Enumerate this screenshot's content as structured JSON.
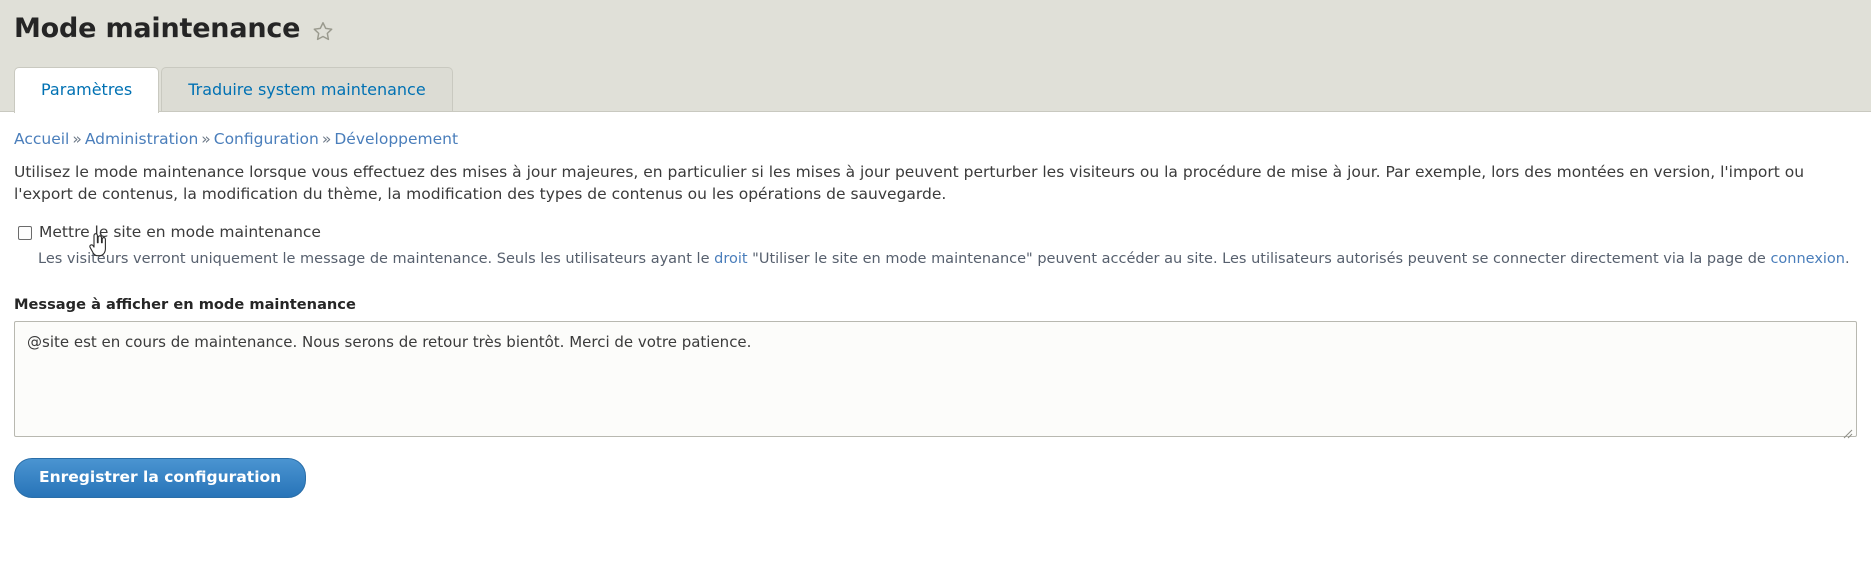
{
  "header": {
    "title": "Mode maintenance",
    "star_icon": "star-outline-icon"
  },
  "tabs": [
    {
      "label": "Paramètres",
      "active": true
    },
    {
      "label": "Traduire system maintenance",
      "active": false
    }
  ],
  "breadcrumb": {
    "separator": "»",
    "items": [
      {
        "label": "Accueil"
      },
      {
        "label": "Administration"
      },
      {
        "label": "Configuration"
      },
      {
        "label": "Développement"
      }
    ]
  },
  "intro": {
    "text": "Utilisez le mode maintenance lorsque vous effectuez des mises à jour majeures, en particulier si les mises à jour peuvent perturber les visiteurs ou la procédure de mise à jour. Par exemple, lors des montées en version, l'import ou l'export de contenus, la modification du thème, la modification des types de contenus ou les opérations de sauvegarde."
  },
  "maintenance_checkbox": {
    "label": "Mettre le site en mode maintenance",
    "checked": false,
    "description": {
      "part1": "Les visiteurs verront uniquement le message de maintenance. Seuls les utilisateurs ayant le ",
      "link1": "droit",
      "part2": " \"Utiliser le site en mode maintenance\" peuvent accéder au site. Les utilisateurs autorisés peuvent se connecter directement via la page de ",
      "link2": "connexion",
      "part3": "."
    }
  },
  "message_field": {
    "label": "Message à afficher en mode maintenance",
    "value": "@site est en cours de maintenance. Nous serons de retour très bientôt. Merci de votre patience.",
    "placeholder": ""
  },
  "submit": {
    "label": "Enregistrer la configuration"
  },
  "colors": {
    "link": "#4a7ebb",
    "tab_link": "#0071b3",
    "header_bg": "#e0e0d8",
    "button": "#2b7ec3",
    "text": "#3b3b3b"
  }
}
